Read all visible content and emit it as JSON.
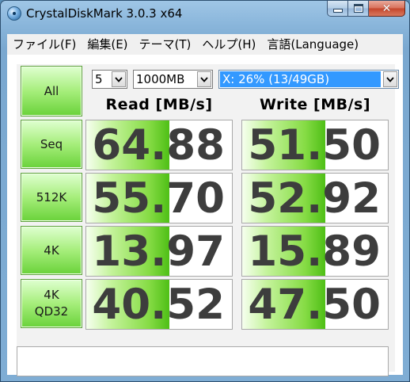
{
  "window": {
    "title": "CrystalDiskMark 3.0.3 x64"
  },
  "menu": [
    "ファイル(F)",
    "編集(E)",
    "テーマ(T)",
    "ヘルプ(H)",
    "言語(Language)"
  ],
  "controls": {
    "all_button": "All",
    "count_value": "5",
    "size_value": "1000MB",
    "drive_value": "X: 26% (13/49GB)"
  },
  "headers": {
    "read": "Read [MB/s]",
    "write": "Write [MB/s]"
  },
  "tests": [
    {
      "label": "Seq",
      "read": "64.88",
      "write": "51.50"
    },
    {
      "label": "512K",
      "read": "55.70",
      "write": "52.92"
    },
    {
      "label": "4K",
      "read": "13.97",
      "write": "15.89"
    },
    {
      "label_line1": "4K",
      "label_line2": "QD32",
      "read": "40.52",
      "write": "47.50"
    }
  ],
  "comment": "",
  "colors": {
    "accent_green": "#6ad23a",
    "selection_blue": "#3399ff",
    "value_text": "#3d3d3d"
  }
}
